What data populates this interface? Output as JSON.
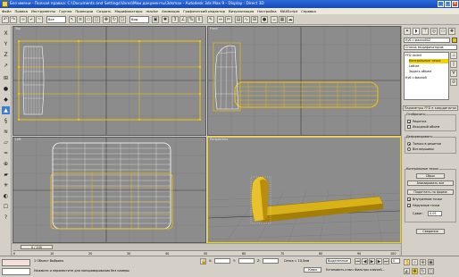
{
  "window": {
    "title": "Без имени - Полная правка: C:\\Documents and Settings\\Varos\\Мои документы\\3dsmax      - Autodesk 3ds Max 9      - Display : Direct 3D",
    "minimize": "_",
    "maximize": "□",
    "close": "✕"
  },
  "menu": [
    "Файл",
    "Правка",
    "Инструменты",
    "Группа",
    "Проекции",
    "Создать",
    "Модификаторы",
    "reactor",
    "Анимация",
    "Графический редактор",
    "Визуализация",
    "Настройка",
    "MAXScript",
    "Справка"
  ],
  "toolbar": {
    "selection_filter": "Все",
    "coord_system": "Вид"
  },
  "viewports": {
    "top": "Top",
    "front": "Front",
    "left": "Left",
    "perspective": "Perspective"
  },
  "command_panel": {
    "object_name": "Куб с фаской02",
    "modifier_list": "Список модификаторов",
    "stack": [
      {
        "label": "FFD 4x4x4",
        "selected": false
      },
      {
        "label": "Контрольные точки",
        "selected": true
      },
      {
        "label": "Lattice",
        "selected": false
      },
      {
        "label": "Задать объем",
        "selected": false
      },
      {
        "label": "Куб с фаской",
        "selected": false
      }
    ],
    "rollout_title": "Параметры FFD в координатах",
    "display_group": "Отобразить:",
    "display_options": [
      {
        "label": "Решетка",
        "checked": true
      },
      {
        "label": "Исходный объем",
        "checked": false
      }
    ],
    "deform_group": "Деформировать:",
    "deform_options": [
      {
        "label": "Только в решетке",
        "on": true
      },
      {
        "label": "Все вершины",
        "on": false
      }
    ],
    "cp_group": "Контрольные точки:",
    "cp_buttons": [
      "Сброс",
      "Анимировать все",
      "Подогнать по форме"
    ],
    "cp_checks": [
      {
        "label": "Внутренние точки",
        "checked": true
      },
      {
        "label": "Наружные точки",
        "checked": true
      }
    ],
    "offset_label": "Сдвиг:",
    "offset_value": "0,05",
    "about_button": "Сведения"
  },
  "timeline": {
    "position": "0 / 100",
    "ticks": [
      "0",
      "10",
      "20",
      "30",
      "40",
      "50",
      "60",
      "70",
      "80",
      "90",
      "100"
    ]
  },
  "status": {
    "selection": "1 Объект Выбрано",
    "prompt": "Нажмите и переместите для панорамирования без камеры",
    "grid": "Сетка = 10,0мм",
    "key_mode": "Ключ",
    "key_filter": "Выделенные",
    "set_key": "Установить ключ",
    "key_filters": "Фильтры ключей...",
    "frame": "0",
    "x_label": "X:",
    "y_label": "Y:",
    "z_label": "Z:"
  },
  "colors": {
    "object_wire": "#f5c400",
    "viewport_bg": "#8c8c8c",
    "active_border": "#f2d200",
    "selection_blue": "#3c7fd0"
  }
}
